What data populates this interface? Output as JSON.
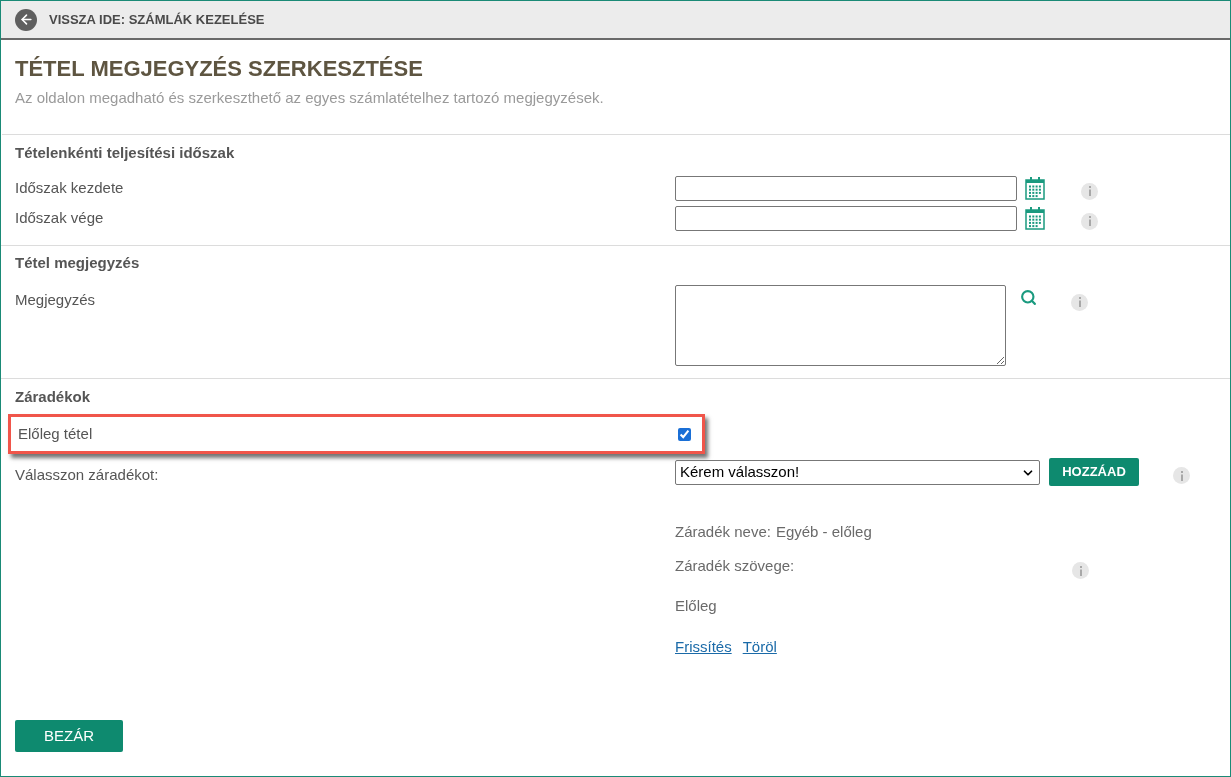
{
  "back_link": {
    "label": "VISSZA IDE: SZÁMLÁK KEZELÉSE"
  },
  "page": {
    "title": "TÉTEL MEGJEGYZÉS SZERKESZTÉSE",
    "subtitle": "Az oldalon megadható és szerkeszthető az egyes számlatételhez tartozó megjegyzések."
  },
  "period_section": {
    "heading": "Tételenkénti teljesítési időszak",
    "fields": [
      {
        "label": "Időszak kezdete"
      },
      {
        "label": "Időszak vége"
      }
    ]
  },
  "note_section": {
    "heading": "Tétel megjegyzés",
    "field": {
      "label": "Megjegyzés"
    }
  },
  "clauses_section": {
    "heading": "Záradékok",
    "advance_item": {
      "label": "Előleg tétel",
      "checked": true,
      "highlighted": true
    },
    "clause_select": {
      "label": "Válasszon záradékot:",
      "value": "Kérem válasszon!",
      "button": "HOZZÁAD"
    },
    "clause_name_label": "Záradék neve:",
    "clause_name_value": "Egyéb - előleg",
    "clause_text_label": "Záradék szövege:",
    "clause_text_value": "Előleg",
    "links": [
      "Frissítés",
      "Töröl"
    ]
  },
  "close_button": "BEZÁR"
}
